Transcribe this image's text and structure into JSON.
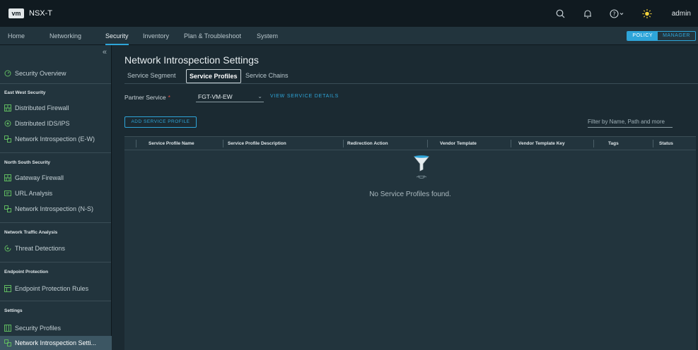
{
  "header": {
    "logo": "vm",
    "app_title": "NSX-T",
    "user": "admin",
    "icons": [
      "search-icon",
      "bell-icon",
      "help-icon",
      "theme-sun-icon"
    ]
  },
  "nav": {
    "items": [
      "Home",
      "Networking",
      "Security",
      "Inventory",
      "Plan & Troubleshoot",
      "System"
    ],
    "active": "Security",
    "mode_policy": "POLICY",
    "mode_manager": "MANAGER"
  },
  "sidebar": {
    "collapse": "«",
    "overview": "Security Overview",
    "sections": [
      {
        "heading": "East West Security",
        "items": [
          "Distributed Firewall",
          "Distributed IDS/IPS",
          "Network Introspection (E-W)"
        ]
      },
      {
        "heading": "North South Security",
        "items": [
          "Gateway Firewall",
          "URL Analysis",
          "Network Introspection (N-S)"
        ]
      },
      {
        "heading": "Network Traffic Analysis",
        "items": [
          "Threat Detections"
        ]
      },
      {
        "heading": "Endpoint Protection",
        "items": [
          "Endpoint Protection Rules"
        ]
      },
      {
        "heading": "Settings",
        "items": [
          "Security Profiles",
          "Network Introspection Setti..."
        ]
      }
    ]
  },
  "main": {
    "title": "Network Introspection Settings",
    "tabs": [
      "Service Segment",
      "Service Profiles",
      "Service Chains"
    ],
    "active_tab": "Service Profiles",
    "partner_label": "Partner Service",
    "partner_required": "*",
    "partner_value": "FGT-VM-EW",
    "view_details": "VIEW SERVICE DETAILS",
    "add_button": "ADD SERVICE PROFILE",
    "filter_placeholder": "Filter by Name, Path and more",
    "columns": [
      "Service Profile Name",
      "Service Profile Description",
      "Redirection Action",
      "Vendor Template",
      "Vendor Template Key",
      "Tags",
      "Status"
    ],
    "empty_text": "No Service Profiles found."
  },
  "colors": {
    "accent": "#2ea5d9",
    "header_bg": "#101a20",
    "sidebar_bg": "#22343d",
    "content_bg": "#1b2a32",
    "selected_bg": "#3c5663",
    "required": "#e0483f"
  }
}
